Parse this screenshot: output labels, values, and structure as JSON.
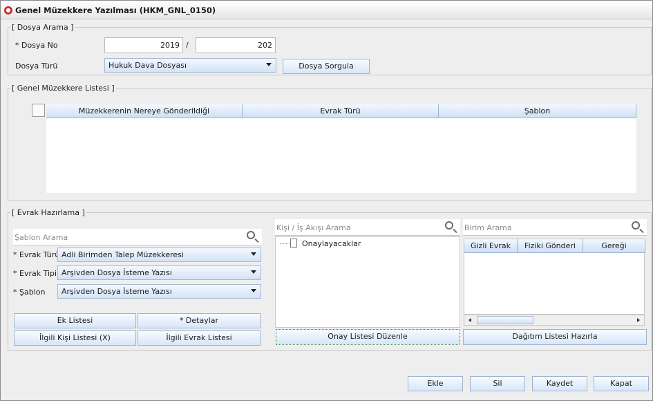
{
  "window": {
    "title": "Genel Müzekkere Yazılması (HKM_GNL_0150)"
  },
  "dosya_arama": {
    "legend": "[ Dosya Arama ]",
    "dosya_no_label": "* Dosya No",
    "dosya_no_year": "2019",
    "separator": "/",
    "dosya_no_number": "202",
    "dosya_turu_label": "Dosya Türü",
    "dosya_turu_value": "Hukuk Dava Dosyası",
    "sorgula_button": "Dosya Sorgula"
  },
  "liste": {
    "legend": "[ Genel Müzekkere Listesi ]",
    "columns": [
      "Müzekkerenin Nereye Gönderildiği",
      "Evrak Türü",
      "Şablon"
    ]
  },
  "evrak_hazirlama": {
    "legend": "[ Evrak Hazırlama ]",
    "sablon_arama_placeholder": "Şablon Arama",
    "evrak_turu_label": "* Evrak Türü",
    "evrak_turu_value": "Adli Birimden Talep Müzekkeresi",
    "evrak_tipi_label": "* Evrak Tipi",
    "evrak_tipi_value": "Arşivden Dosya İsteme Yazısı",
    "sablon_label": "* Şablon",
    "sablon_value": "Arşivden Dosya İsteme Yazısı",
    "ek_listesi_button": "Ek Listesi",
    "detaylar_button": "* Detaylar",
    "ilgili_kisi_button": "İlgili Kişi Listesi (X)",
    "ilgili_evrak_button": "İlgili Evrak Listesi",
    "kisi_arama_placeholder": "Kişi / İş Akışı Arama",
    "tree_node": "Onaylayacaklar",
    "onay_listesi_button": "Onay Listesi Düzenle",
    "birim_arama_placeholder": "Birim Arama",
    "birim_columns": [
      "Gizli Evrak",
      "Fiziki Gönderi",
      "Gereği"
    ],
    "dagitim_button": "Dağıtım Listesi Hazırla"
  },
  "footer": {
    "ekle": "Ekle",
    "sil": "Sil",
    "kaydet": "Kaydet",
    "kapat": "Kapat"
  }
}
